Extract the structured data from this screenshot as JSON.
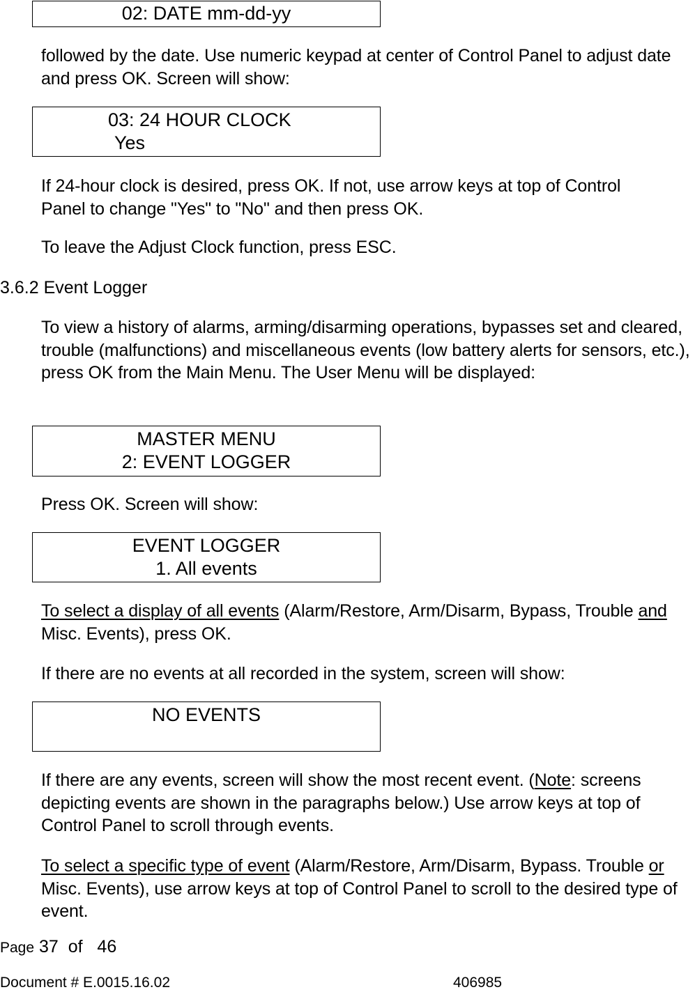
{
  "screens": {
    "date": {
      "lines": [
        "02: DATE mm-dd-yy"
      ]
    },
    "clock": {
      "lines": [
        "03: 24 HOUR CLOCK",
        "Yes"
      ]
    },
    "master_menu": {
      "lines": [
        "MASTER MENU",
        "2: EVENT LOGGER"
      ]
    },
    "event_logger": {
      "lines": [
        "EVENT LOGGER",
        "1. All events"
      ]
    },
    "no_events": {
      "lines": [
        "NO EVENTS",
        ""
      ]
    }
  },
  "paragraphs": {
    "p1": {
      "text": "followed by the date. Use numeric keypad at center of Control Panel to adjust date and press OK. Screen will show:"
    },
    "p2": {
      "text": "If 24-hour clock is desired, press OK. If not, use arrow keys at top of Control Panel to change \"Yes\" to \"No\" and then press OK."
    },
    "p3": {
      "text": "To leave the Adjust Clock function, press ESC."
    },
    "p4": {
      "text": "To view a history of alarms, arming/disarming operations, bypasses set and cleared, trouble (malfunctions) and miscellaneous events (low battery alerts for sensors, etc.), press OK from the Main Menu. The User Menu will be displayed:"
    },
    "p5": {
      "text": "Press OK. Screen will show:"
    },
    "p6": {
      "underlined_lead": "To select a display of all events",
      "middle": " (Alarm/Restore, Arm/Disarm, Bypass, Trouble ",
      "underlined_word": "and",
      "tail": " Misc. Events), press OK."
    },
    "p7": {
      "text": "If there are no events at all recorded in the system, screen will show:"
    },
    "p8": {
      "lead": "If there are any events, screen will show the most recent event. (",
      "underlined_word": "Note",
      "tail": ": screens depicting events are shown in the paragraphs below.) Use arrow keys at top of Control Panel to scroll through events."
    },
    "p9": {
      "underlined_lead": "To select a specific type of event",
      "middle": " (Alarm/Restore, Arm/Disarm, Bypass. Trouble ",
      "underlined_word": "or",
      "tail": " Misc. Events), use arrow keys at top of Control Panel to scroll to the desired type of event."
    }
  },
  "section": {
    "number": "3.6.2",
    "title": "Event Logger"
  },
  "footer": {
    "page_label": "Page",
    "page_current": "37",
    "page_of": "of",
    "page_total": "46",
    "document_label": "Document # E.0015.16.02",
    "document_number": "406985"
  }
}
